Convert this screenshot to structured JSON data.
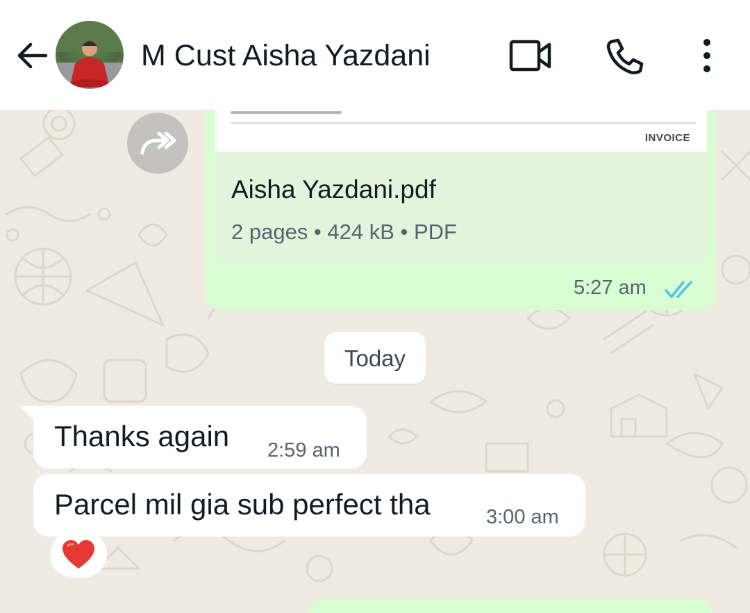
{
  "header": {
    "contact_name": "M Cust Aisha Yazdani",
    "back_icon": "arrow-left-icon",
    "video_icon": "video-camera-icon",
    "call_icon": "phone-icon",
    "more_icon": "more-vertical-icon"
  },
  "messages": {
    "document": {
      "preview_label": "INVOICE",
      "file_name": "Aisha Yazdani.pdf",
      "meta": "2 pages • 424 kB • PDF",
      "time": "5:27 am",
      "status_icon": "double-check-read-icon"
    },
    "date_divider": "Today",
    "incoming": [
      {
        "text": "Thanks again",
        "time": "2:59 am"
      },
      {
        "text": "Parcel mil gia sub perfect tha",
        "time": "3:00 am",
        "reaction": "❤️"
      }
    ]
  },
  "colors": {
    "outgoing_bubble": "#d9fdd3",
    "incoming_bubble": "#ffffff",
    "read_tick": "#53bdeb",
    "wallpaper": "#efeae2"
  }
}
